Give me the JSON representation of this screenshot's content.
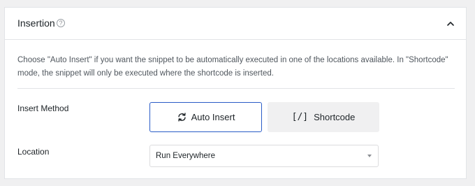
{
  "panel": {
    "title": "Insertion",
    "help_icon": "question-circle-icon",
    "toggle_icon": "chevron-up-icon"
  },
  "description": "Choose \"Auto Insert\" if you want the snippet to be automatically executed in one of the locations available. In \"Shortcode\" mode, the snippet will only be executed where the shortcode is inserted.",
  "insert_method": {
    "label": "Insert Method",
    "options": [
      {
        "label": "Auto Insert",
        "icon": "refresh-icon",
        "selected": true
      },
      {
        "label": "Shortcode",
        "icon": "[/]",
        "selected": false
      }
    ]
  },
  "location": {
    "label": "Location",
    "value": "Run Everywhere"
  },
  "colors": {
    "accent": "#2a5cc7",
    "border": "#e2e4e7",
    "inactive_bg": "#f0f0f1"
  }
}
